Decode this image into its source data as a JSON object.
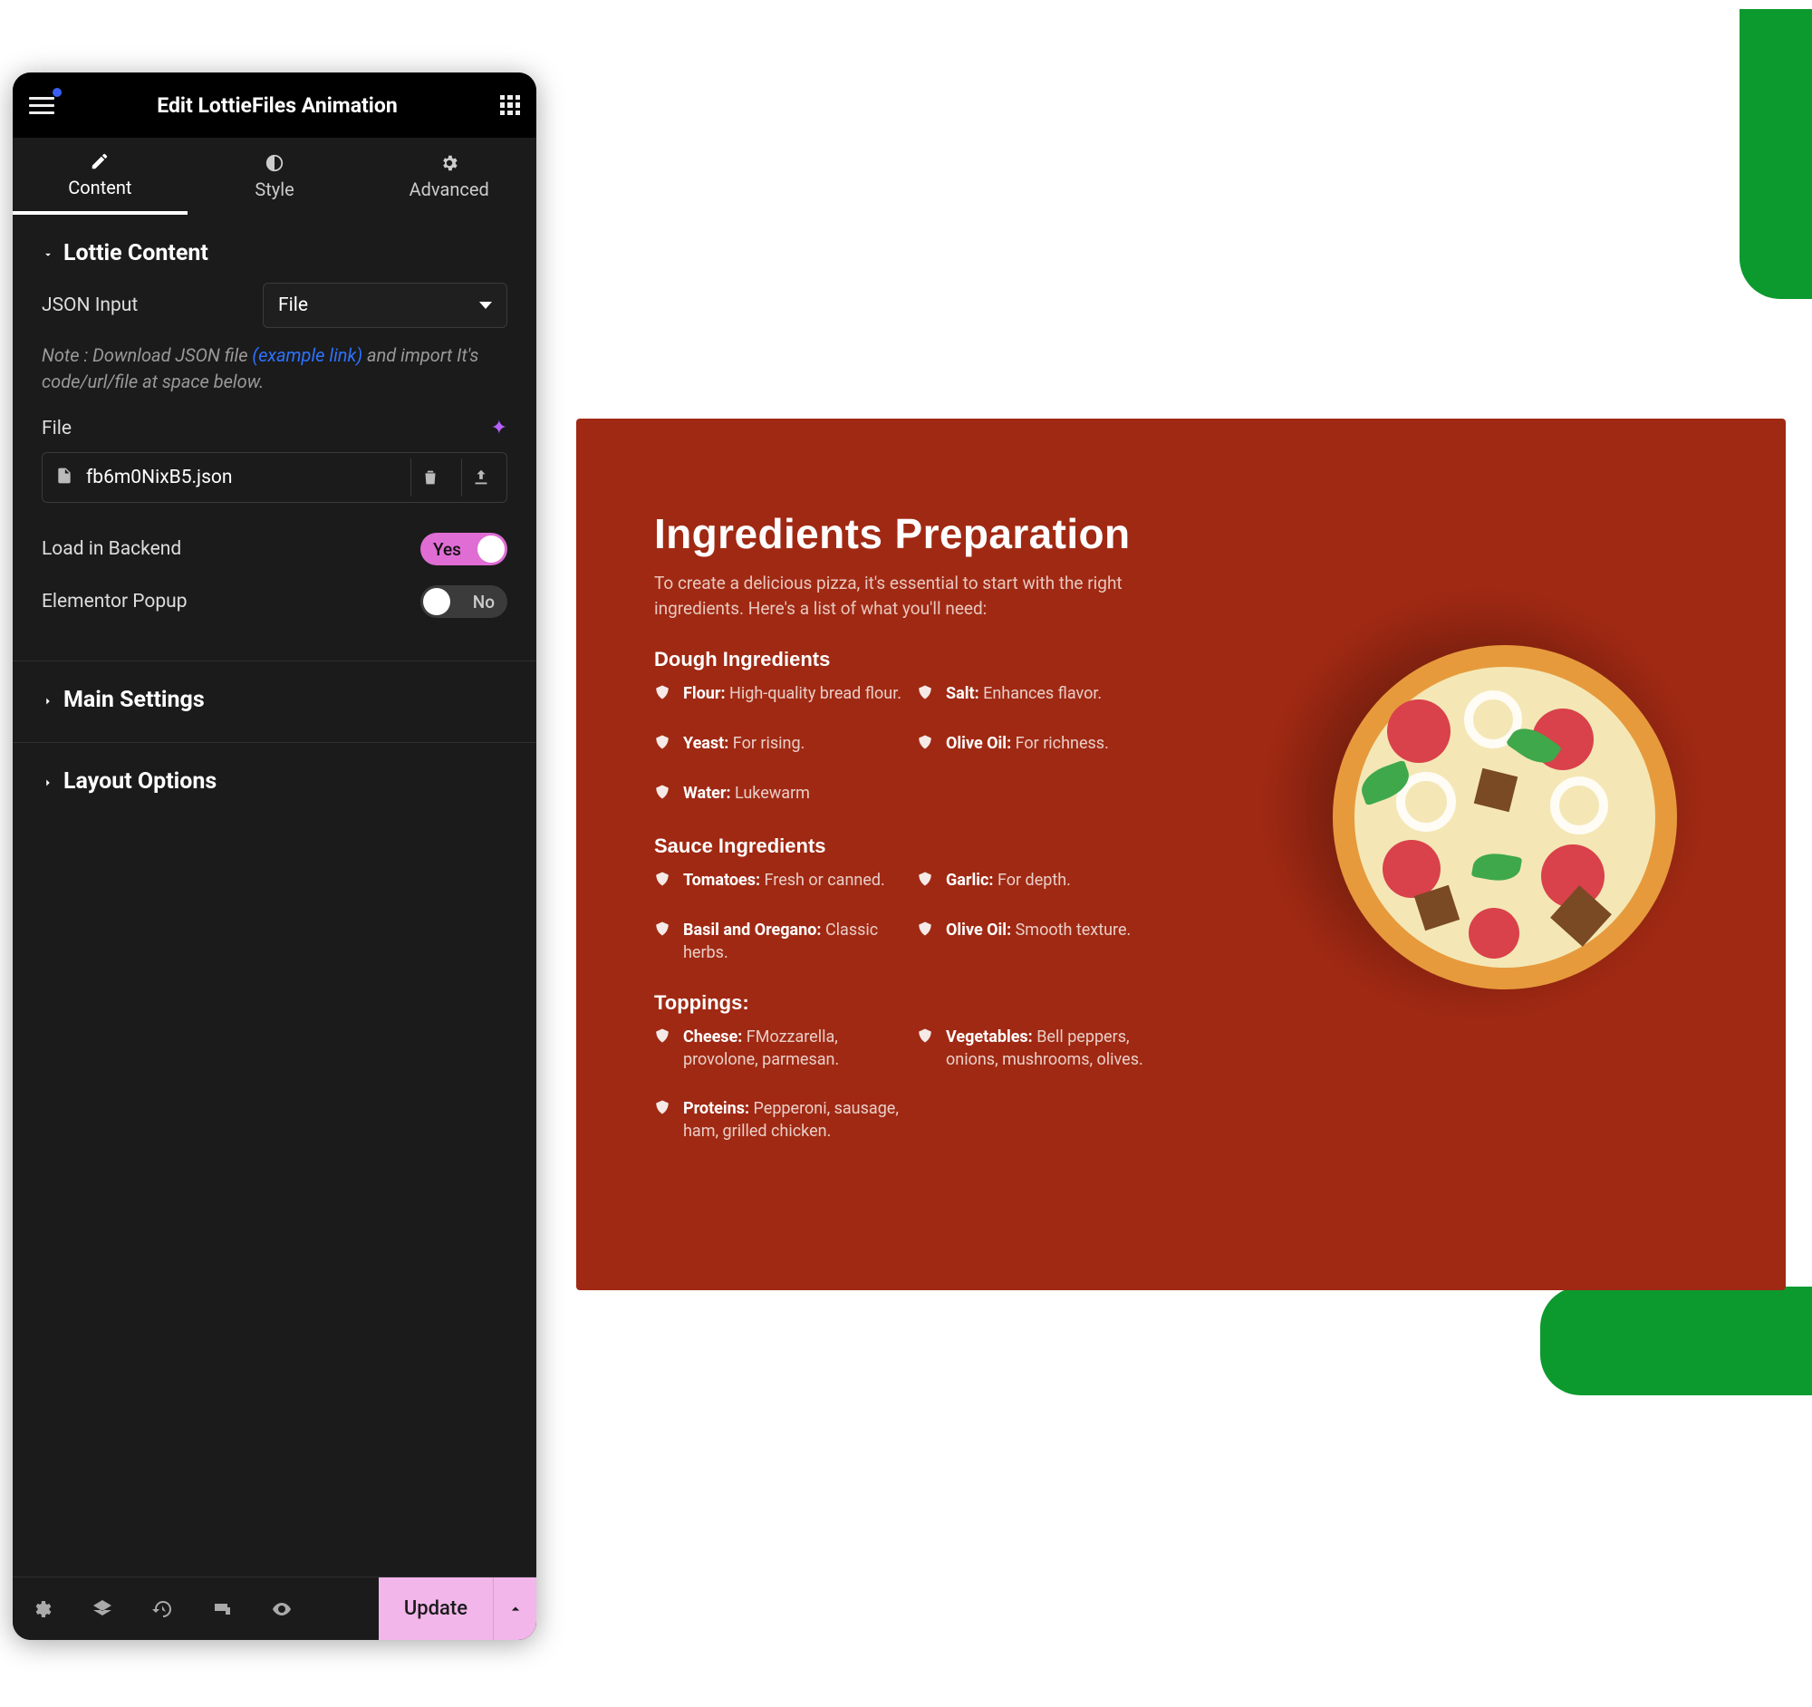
{
  "header": {
    "title": "Edit LottieFiles Animation"
  },
  "tabs": {
    "content": "Content",
    "style": "Style",
    "advanced": "Advanced"
  },
  "section1": {
    "title": "Lottie Content",
    "json_input_label": "JSON Input",
    "json_input_value": "File",
    "note_pre": "Note : Download JSON file ",
    "note_link": "(example link)",
    "note_post": " and import It's code/url/file at space below.",
    "file_label": "File",
    "file_value": "fb6m0NixB5.json",
    "load_backend_label": "Load in Backend",
    "load_backend_state": "Yes",
    "popup_label": "Elementor Popup",
    "popup_state": "No"
  },
  "section2": {
    "title": "Main Settings"
  },
  "section3": {
    "title": "Layout Options"
  },
  "footer": {
    "update": "Update"
  },
  "preview": {
    "title": "Ingredients Preparation",
    "subtitle": "To create a delicious pizza, it's essential to start with the right ingredients. Here's a list of what you'll need:",
    "cat1": "Dough Ingredients",
    "dough": [
      {
        "k": "Flour:",
        "v": " High-quality bread flour."
      },
      {
        "k": "Salt:",
        "v": " Enhances flavor."
      },
      {
        "k": "Yeast:",
        "v": " For rising."
      },
      {
        "k": "Olive Oil:",
        "v": " For richness."
      },
      {
        "k": "Water:",
        "v": " Lukewarm"
      }
    ],
    "cat2": "Sauce Ingredients",
    "sauce": [
      {
        "k": "Tomatoes:",
        "v": " Fresh or canned."
      },
      {
        "k": "Garlic:",
        "v": " For depth."
      },
      {
        "k": "Basil and Oregano:",
        "v": " Classic herbs."
      },
      {
        "k": "Olive Oil:",
        "v": " Smooth texture."
      }
    ],
    "cat3": "Toppings:",
    "top": [
      {
        "k": "Cheese:",
        "v": " FMozzarella, provolone, parmesan."
      },
      {
        "k": "Vegetables:",
        "v": " Bell peppers, onions, mushrooms, olives."
      },
      {
        "k": "Proteins:",
        "v": " Pepperoni, sausage, ham, grilled chicken."
      }
    ]
  }
}
